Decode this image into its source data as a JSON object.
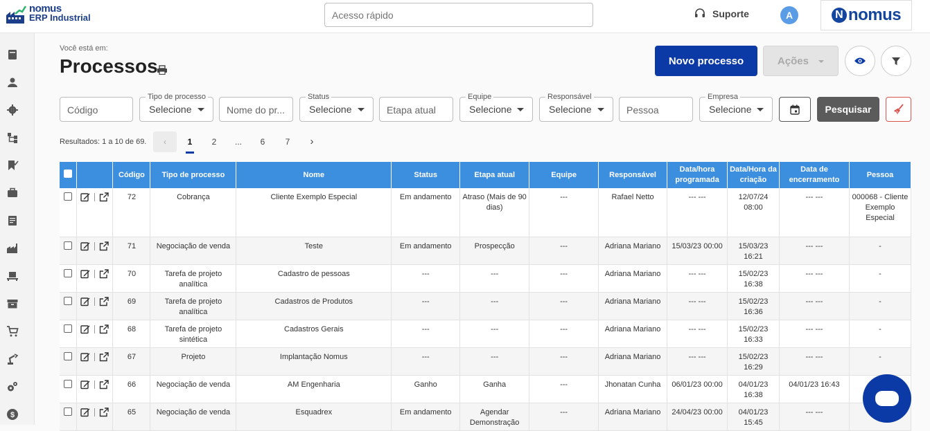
{
  "app": {
    "name_line1": "nomus",
    "name_line2": "ERP Industrial",
    "brand": "nomus"
  },
  "header": {
    "quick_access_placeholder": "Acesso rápido",
    "support_label": "Suporte",
    "avatar_letter": "A"
  },
  "page": {
    "breadcrumb": "Você está em:",
    "title": "Processos"
  },
  "toolbar": {
    "new_label": "Novo processo",
    "actions_label": "Ações"
  },
  "filters": {
    "codigo": "Código",
    "tipo_label": "Tipo de processo",
    "tipo_value": "Selecione",
    "nome": "Nome do pr...",
    "status_label": "Status",
    "status_value": "Selecione",
    "etapa": "Etapa atual",
    "equipe_label": "Equipe",
    "equipe_value": "Selecione",
    "responsavel_label": "Responsável",
    "responsavel_value": "Selecione",
    "pessoa": "Pessoa",
    "empresa_label": "Empresa",
    "empresa_value": "Selecione",
    "search_label": "Pesquisar"
  },
  "pagination": {
    "results": "Resultados: 1 a 10 de 69.",
    "pages": [
      "1",
      "2",
      "...",
      "6",
      "7"
    ],
    "current": "1"
  },
  "table": {
    "headers": [
      "Código",
      "Tipo de processo",
      "Nome",
      "Status",
      "Etapa atual",
      "Equipe",
      "Responsável",
      "Data/hora programada",
      "Data/Hora da criação",
      "Data de encerramento",
      "Pessoa"
    ],
    "rows": [
      [
        "72",
        "Cobrança",
        "Cliente Exemplo Especial",
        "Em andamento",
        "Atraso (Mais de 90 dias)",
        "---",
        "Rafael Netto",
        "--- ---",
        "12/07/24 08:00",
        "--- ---",
        "000068 - Cliente Exemplo Especial"
      ],
      [
        "71",
        "Negociação de venda",
        "Teste",
        "Em andamento",
        "Prospecção",
        "---",
        "Adriana Mariano",
        "15/03/23 00:00",
        "15/03/23 16:21",
        "--- ---",
        "-"
      ],
      [
        "70",
        "Tarefa de projeto analítica",
        "Cadastro de pessoas",
        "---",
        "---",
        "---",
        "Adriana Mariano",
        "--- ---",
        "15/02/23 16:38",
        "--- ---",
        "-"
      ],
      [
        "69",
        "Tarefa de projeto analítica",
        "Cadastros de Produtos",
        "---",
        "---",
        "---",
        "Adriana Mariano",
        "--- ---",
        "15/02/23 16:36",
        "--- ---",
        "-"
      ],
      [
        "68",
        "Tarefa de projeto sintética",
        "Cadastros Gerais",
        "---",
        "---",
        "---",
        "Adriana Mariano",
        "--- ---",
        "15/02/23 16:33",
        "--- ---",
        "-"
      ],
      [
        "67",
        "Projeto",
        "Implantação Nomus",
        "---",
        "---",
        "---",
        "Adriana Mariano",
        "--- ---",
        "15/02/23 16:29",
        "--- ---",
        "-"
      ],
      [
        "66",
        "Negociação de venda",
        "AM Engenharia",
        "Ganho",
        "Ganha",
        "---",
        "Jhonatan Cunha",
        "06/01/23 00:00",
        "04/01/23 16:38",
        "04/01/23 16:43",
        ""
      ],
      [
        "65",
        "Negociação de venda",
        "Esquadrex",
        "Em andamento",
        "Agendar Demonstração",
        "---",
        "Adriana Mariano",
        "24/04/23 00:00",
        "04/01/23 15:45",
        "--- ---",
        ""
      ]
    ]
  },
  "colors": {
    "primary": "#0b3aa6",
    "table_header": "#3c8ede",
    "search_button": "#5b5b5b"
  }
}
